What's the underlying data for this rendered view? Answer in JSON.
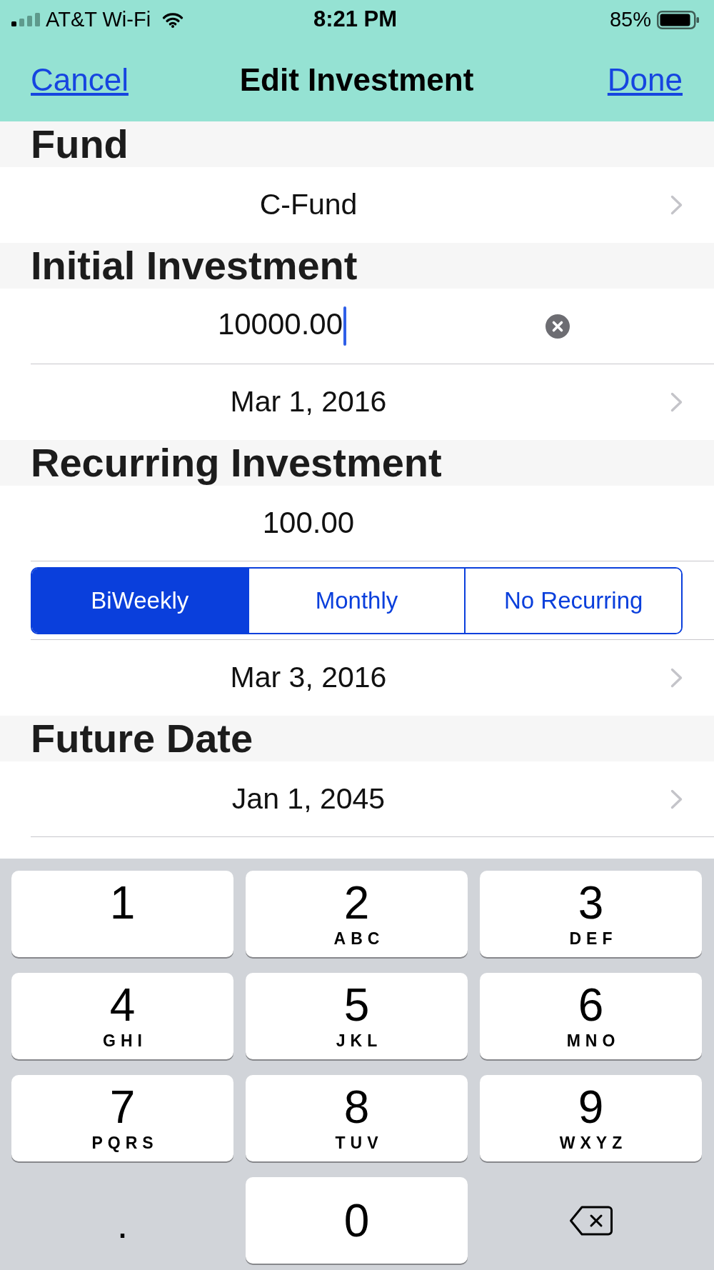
{
  "status_bar": {
    "carrier": "AT&T Wi-Fi",
    "time": "8:21 PM",
    "battery": "85%"
  },
  "navigation_bar": {
    "cancel": "Cancel",
    "title": "Edit Investment",
    "done": "Done"
  },
  "sections": [
    {
      "title": "Fund",
      "rows": [
        {
          "kind": "disclosure",
          "value": "C-Fund"
        }
      ]
    },
    {
      "title": "Initial Investment",
      "rows": [
        {
          "kind": "text_field",
          "value": "10000.00",
          "focused": true
        },
        {
          "kind": "disclosure",
          "value": "Mar 1, 2016"
        }
      ]
    },
    {
      "title": "Recurring Investment",
      "rows": [
        {
          "kind": "text_field",
          "value": "100.00",
          "focused": false
        },
        {
          "kind": "segmented",
          "segments": [
            {
              "label": "BiWeekly",
              "selected": true
            },
            {
              "label": "Monthly",
              "selected": false
            },
            {
              "label": "No Recurring",
              "selected": false
            }
          ]
        },
        {
          "kind": "disclosure",
          "value": "Mar 3, 2016"
        }
      ]
    },
    {
      "title": "Future Date",
      "rows": [
        {
          "kind": "disclosure",
          "value": "Jan 1, 2045"
        }
      ]
    }
  ],
  "keypad": {
    "rows": [
      [
        {
          "kind": "digit",
          "digit": "1"
        },
        {
          "kind": "digit",
          "digit": "2",
          "letters": "ABC"
        },
        {
          "kind": "digit",
          "digit": "3",
          "letters": "DEF"
        }
      ],
      [
        {
          "kind": "digit",
          "digit": "4",
          "letters": "GHI"
        },
        {
          "kind": "digit",
          "digit": "5",
          "letters": "JKL"
        },
        {
          "kind": "digit",
          "digit": "6",
          "letters": "MNO"
        }
      ],
      [
        {
          "kind": "digit",
          "digit": "7",
          "letters": "PQRS"
        },
        {
          "kind": "digit",
          "digit": "8",
          "letters": "TUV"
        },
        {
          "kind": "digit",
          "digit": "9",
          "letters": "WXYZ"
        }
      ],
      [
        {
          "kind": "decimal",
          "label": "."
        },
        {
          "kind": "digit",
          "digit": "0"
        },
        {
          "kind": "delete"
        }
      ]
    ]
  }
}
